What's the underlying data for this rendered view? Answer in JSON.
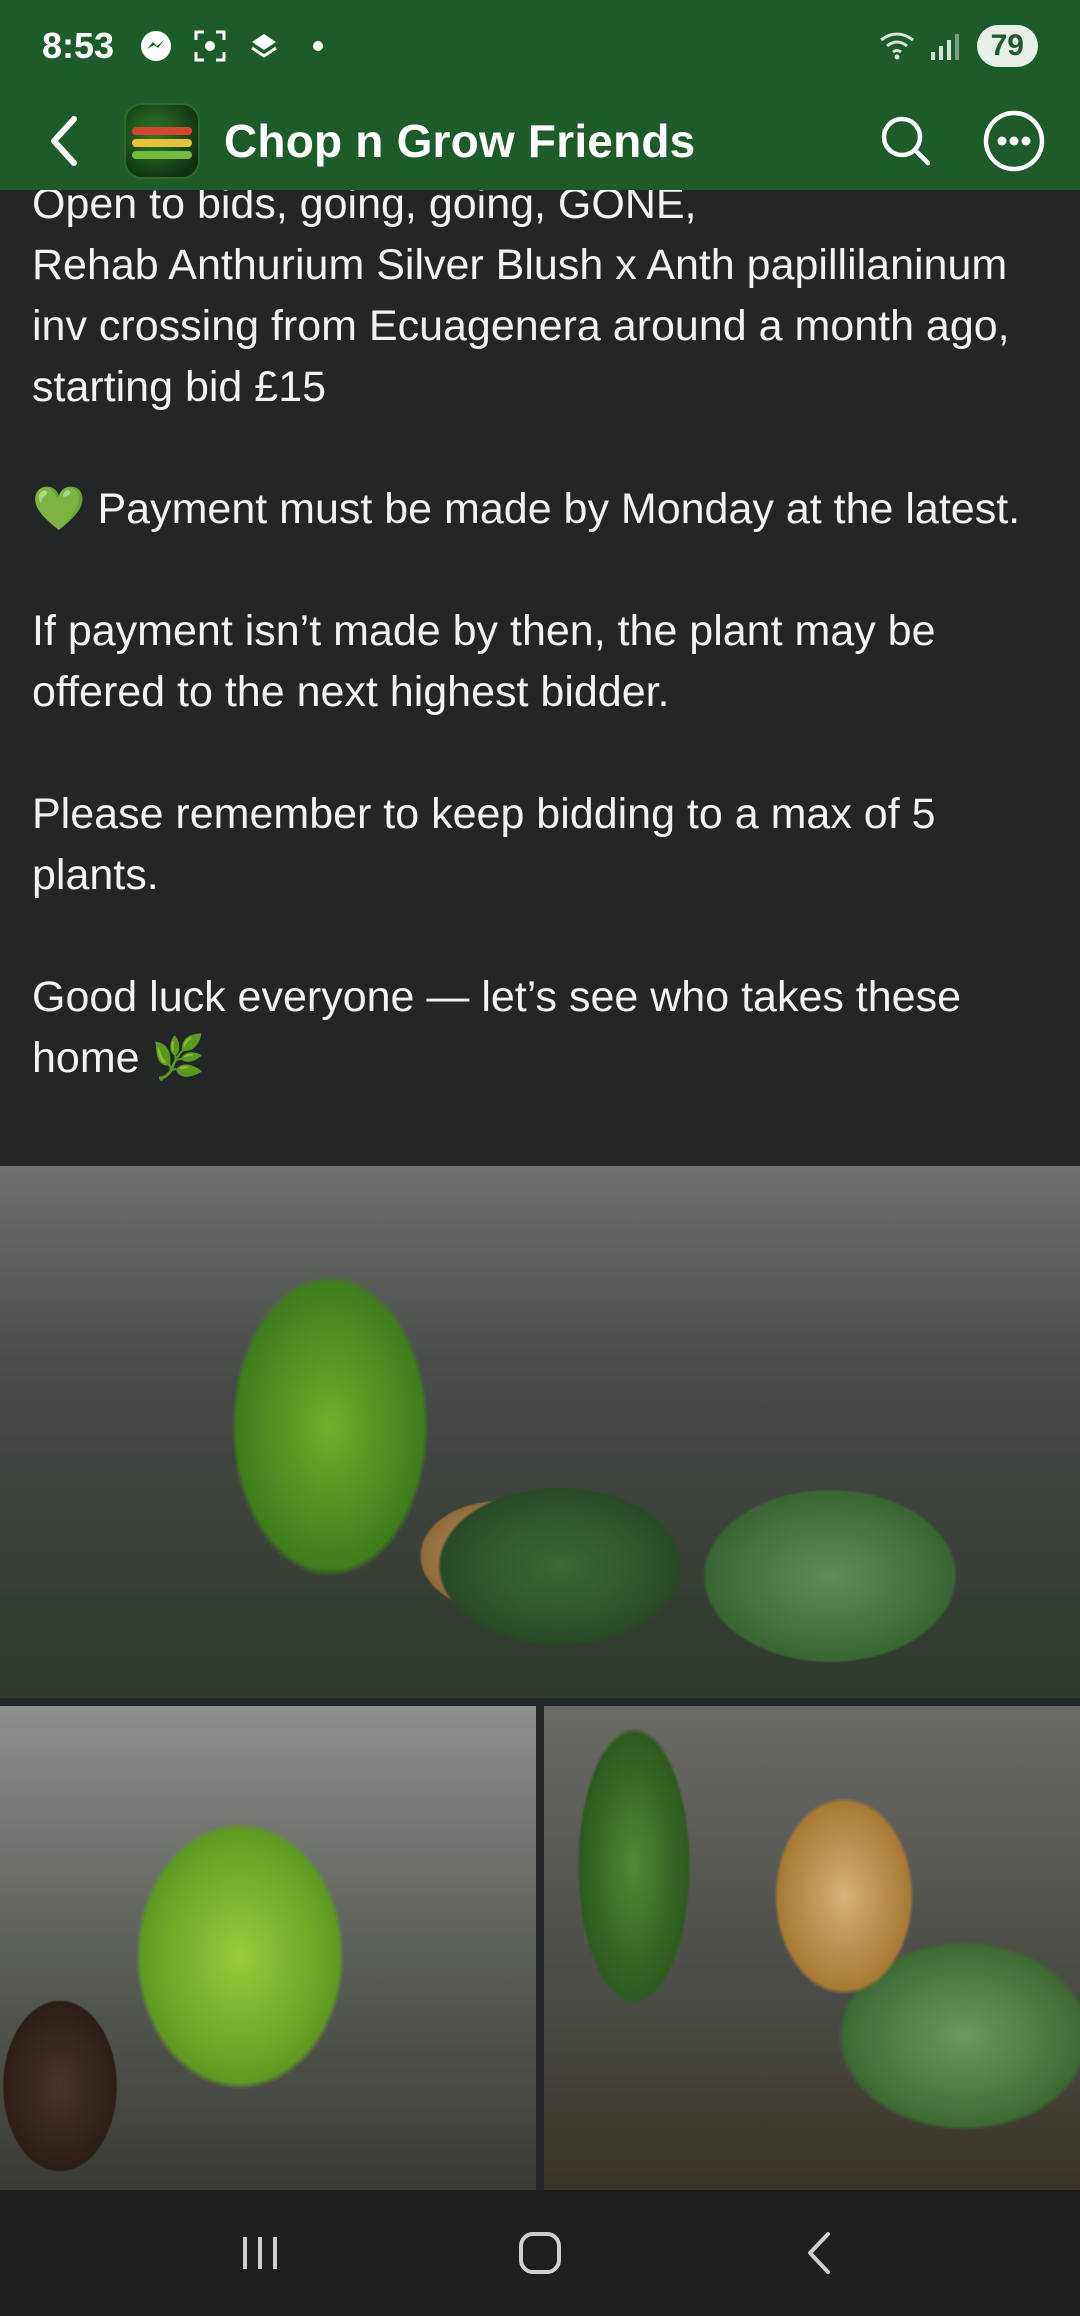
{
  "status_bar": {
    "time": "8:53",
    "battery": "79",
    "left_icons": [
      "messenger-icon",
      "screenshot-icon",
      "app-icon",
      "dot-icon"
    ],
    "right_icons": [
      "wifi-icon",
      "signal-icon"
    ]
  },
  "app_bar": {
    "group_name": "Chop n Grow Friends",
    "accent_color": "#1c5b2a"
  },
  "post": {
    "first_line": "Open to bids, going, going, GONE,",
    "description": "Rehab Anthurium Silver Blush x Anth papillilaninum inv crossing from Ecuagenera around a month ago, starting bid £15",
    "payment_emoji": "💚",
    "payment_text": "Payment must be made by Monday at the latest.",
    "next_bidder": "If payment isn’t made by then, the plant may be offered to the next highest bidder.",
    "reminder": "Please remember to keep bidding to a max of 5 plants.",
    "good_luck": "Good luck everyone — let’s see who takes these home",
    "good_luck_emoji": "🌿"
  },
  "photos": [
    "anthurium-plant-photo-1",
    "anthurium-plant-photo-2",
    "anthurium-plant-photo-3"
  ]
}
